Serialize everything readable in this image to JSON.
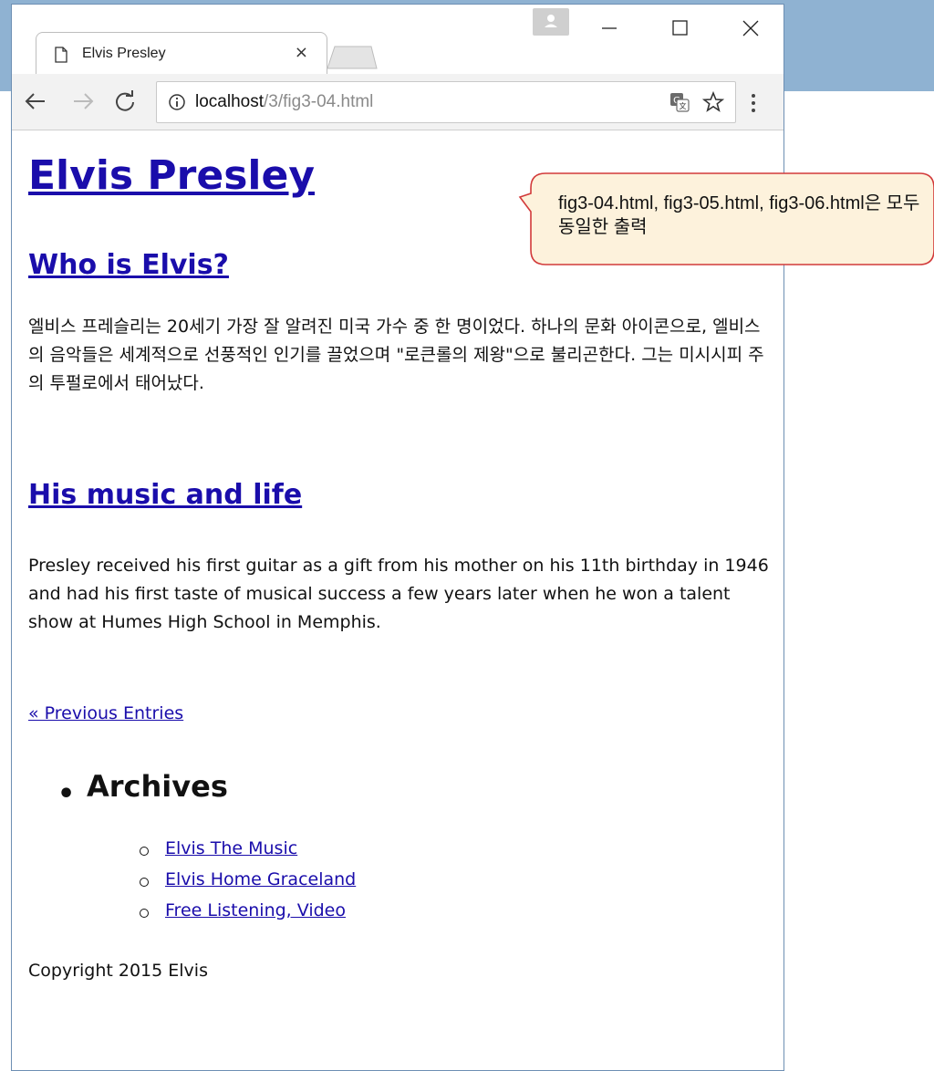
{
  "browser": {
    "tab_title": "Elvis Presley",
    "tab_close": "×",
    "url_host": "localhost",
    "url_path": "/3/fig3-04.html"
  },
  "page": {
    "h1": "Elvis Presley",
    "section1_heading": "Who is Elvis?",
    "section1_text": "엘비스 프레슬리는 20세기 가장 잘 알려진 미국 가수 중 한 명이었다. 하나의 문화 아이콘으로, 엘비스의 음악들은 세계적으로 선풍적인 인기를 끌었으며 \"로큰롤의 제왕\"으로 불리곤한다. 그는 미시시피 주의 투펄로에서 태어났다.",
    "section2_heading": "His music and life",
    "section2_text": "Presley received his first guitar as a gift from his mother on his 11th birthday in 1946 and had his first taste of musical success a few years later when he won a talent show at Humes High School in Memphis.",
    "prev_link": "« Previous Entries",
    "archives_title": "Archives",
    "archives": [
      {
        "label": "Elvis The Music"
      },
      {
        "label": "Elvis Home Graceland"
      },
      {
        "label": "Free Listening, Video"
      }
    ],
    "copyright": "Copyright 2015 Elvis"
  },
  "callout": {
    "text": "fig3-04.html, fig3-05.html, fig3-06.html은 모두 동일한 출력"
  },
  "colors": {
    "link": "#1a0dab",
    "visited": "#5b1a8a",
    "callout_bg": "#fdf2dc",
    "callout_border": "#d23a3a",
    "desktop": "#8fb2d2"
  }
}
